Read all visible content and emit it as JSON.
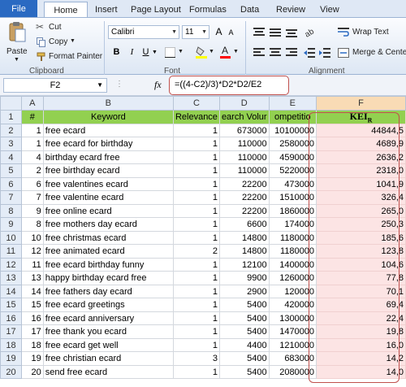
{
  "tabs": {
    "file": "File",
    "home": "Home",
    "insert": "Insert",
    "page_layout": "Page Layout",
    "formulas": "Formulas",
    "data": "Data",
    "review": "Review",
    "view": "View"
  },
  "ribbon": {
    "paste": "Paste",
    "cut": "Cut",
    "copy": "Copy",
    "format_painter": "Format Painter",
    "clipboard": "Clipboard",
    "font_name": "Calibri",
    "font_size": "11",
    "font": "Font",
    "bold": "B",
    "italic": "I",
    "underline": "U",
    "wrap_text": "Wrap Text",
    "merge_center": "Merge & Cente",
    "alignment": "Alignment",
    "grow_font": "A",
    "shrink_font": "A",
    "font_color_letter": "A"
  },
  "formula_bar": {
    "name_box": "F2",
    "fx": "fx",
    "formula": "=((4-C2)/3)*D2*D2/E2"
  },
  "columns": [
    "A",
    "B",
    "C",
    "D",
    "E",
    "F"
  ],
  "header_row": {
    "row": "1",
    "a": "#",
    "b": "Keyword",
    "c": "Relevance",
    "d": "earch Volur",
    "e": "ompetitio",
    "f": "KEI",
    "f_sub": "R"
  },
  "rows": [
    {
      "row": "2",
      "a": "1",
      "b": "free ecard",
      "c": "1",
      "d": "673000",
      "e": "10100000",
      "f": "44844,5"
    },
    {
      "row": "3",
      "a": "1",
      "b": "free ecard for birthday",
      "c": "1",
      "d": "110000",
      "e": "2580000",
      "f": "4689,9"
    },
    {
      "row": "4",
      "a": "4",
      "b": "birthday ecard free",
      "c": "1",
      "d": "110000",
      "e": "4590000",
      "f": "2636,2"
    },
    {
      "row": "5",
      "a": "2",
      "b": "free birthday ecard",
      "c": "1",
      "d": "110000",
      "e": "5220000",
      "f": "2318,0"
    },
    {
      "row": "6",
      "a": "6",
      "b": "free valentines ecard",
      "c": "1",
      "d": "22200",
      "e": "473000",
      "f": "1041,9"
    },
    {
      "row": "7",
      "a": "7",
      "b": "free valentine ecard",
      "c": "1",
      "d": "22200",
      "e": "1510000",
      "f": "326,4"
    },
    {
      "row": "8",
      "a": "9",
      "b": "free online ecard",
      "c": "1",
      "d": "22200",
      "e": "1860000",
      "f": "265,0"
    },
    {
      "row": "9",
      "a": "8",
      "b": "free mothers day ecard",
      "c": "1",
      "d": "6600",
      "e": "174000",
      "f": "250,3"
    },
    {
      "row": "10",
      "a": "10",
      "b": "free christmas ecard",
      "c": "1",
      "d": "14800",
      "e": "1180000",
      "f": "185,6"
    },
    {
      "row": "11",
      "a": "12",
      "b": "free animated ecard",
      "c": "2",
      "d": "14800",
      "e": "1180000",
      "f": "123,8"
    },
    {
      "row": "12",
      "a": "11",
      "b": "free ecard birthday funny",
      "c": "1",
      "d": "12100",
      "e": "1400000",
      "f": "104,6"
    },
    {
      "row": "13",
      "a": "13",
      "b": "happy birthday ecard free",
      "c": "1",
      "d": "9900",
      "e": "1260000",
      "f": "77,8"
    },
    {
      "row": "14",
      "a": "14",
      "b": "free fathers day ecard",
      "c": "1",
      "d": "2900",
      "e": "120000",
      "f": "70,1"
    },
    {
      "row": "15",
      "a": "15",
      "b": "free ecard greetings",
      "c": "1",
      "d": "5400",
      "e": "420000",
      "f": "69,4"
    },
    {
      "row": "16",
      "a": "16",
      "b": "free ecard anniversary",
      "c": "1",
      "d": "5400",
      "e": "1300000",
      "f": "22,4"
    },
    {
      "row": "17",
      "a": "17",
      "b": "free thank you ecard",
      "c": "1",
      "d": "5400",
      "e": "1470000",
      "f": "19,8"
    },
    {
      "row": "18",
      "a": "18",
      "b": "free ecard get well",
      "c": "1",
      "d": "4400",
      "e": "1210000",
      "f": "16,0"
    },
    {
      "row": "19",
      "a": "19",
      "b": "free christian ecard",
      "c": "3",
      "d": "5400",
      "e": "683000",
      "f": "14,2"
    },
    {
      "row": "20",
      "a": "20",
      "b": "send free ecard",
      "c": "1",
      "d": "5400",
      "e": "2080000",
      "f": "14,0"
    }
  ],
  "colors": {
    "header_green": "#92d050",
    "highlight": "#c0504d",
    "kei_fill": "#fce4e4",
    "file_tab": "#2a6ac2"
  }
}
